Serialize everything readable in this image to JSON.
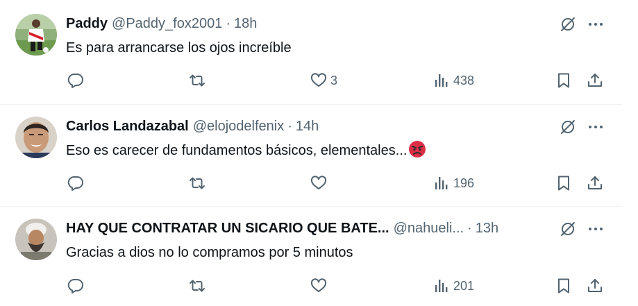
{
  "tweets": [
    {
      "name": "Paddy",
      "handle": "@Paddy_fox2001",
      "separator": "·",
      "time": "18h",
      "text": "Es para arrancarse los ojos increíble",
      "likes": "3",
      "views": "438"
    },
    {
      "name": "Carlos Landazabal",
      "handle": "@elojodelfenix",
      "separator": "·",
      "time": "14h",
      "text": "Eso es carecer de fundamentos básicos, elementales...",
      "emoji": "angry-face-icon",
      "likes": "",
      "views": "196"
    },
    {
      "name": "HAY QUE CONTRATAR UN SICARIO QUE BATE...",
      "handle": "@nahueli...",
      "separator": "·",
      "time": "13h",
      "text": "Gracias a dios no lo compramos por 5 minutos",
      "likes": "",
      "views": "201"
    }
  ],
  "icons": {
    "reply": "reply-icon",
    "retweet": "retweet-icon",
    "like": "heart-icon",
    "views": "views-chart-icon",
    "bookmark": "bookmark-icon",
    "share": "share-icon",
    "grok": "grok-icon",
    "more": "more-options-icon"
  },
  "colors": {
    "text": "#0f1419",
    "secondary": "#536471",
    "divider": "#eff3f4"
  }
}
